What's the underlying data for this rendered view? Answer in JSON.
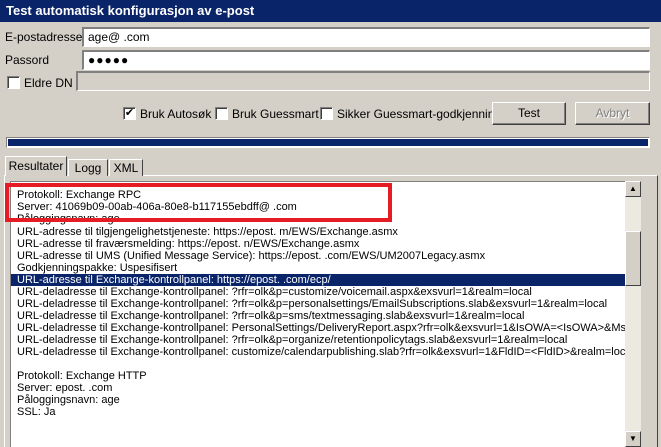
{
  "window": {
    "title": "Test automatisk konfigurasjon av e-post"
  },
  "form": {
    "email_label": "E-postadresse",
    "email_value": "age@            .com",
    "password_label": "Passord",
    "password_value": "●●●●●",
    "legacy_dn_label": "Eldre DN",
    "legacy_dn_value": ""
  },
  "options": {
    "autodiscover_label": "Bruk Autosøk",
    "autodiscover_checked": true,
    "autodiscover_mark": "✔",
    "guessmart_label": "Bruk Guessmart",
    "guessmart_checked": false,
    "secure_guessmart_label": "Sikker Guessmart-godkjenning",
    "secure_guessmart_checked": false
  },
  "buttons": {
    "test": "Test",
    "cancel": "Avbryt"
  },
  "progress": {
    "fraction": 1.0
  },
  "tabs": [
    "Resultater",
    "Logg",
    "XML"
  ],
  "results": {
    "selected_index": 7,
    "lines": [
      "Protokoll: Exchange RPC",
      "Server: 41069b09-00ab-406a-80e8-b117155ebdff@            .com",
      "Påloggingsnavn: age",
      "URL-adresse til tilgjengelighetstjeneste: https://epost.           m/EWS/Exchange.asmx",
      "URL-adresse til fraværsmelding: https://epost.            n/EWS/Exchange.asmx",
      "URL-adresse til UMS (Unified Message Service): https://epost.             .com/EWS/UM2007Legacy.asmx",
      "Godkjenningspakke: Uspesifisert",
      "URL-adresse til Exchange-kontrollpanel: https://epost.          .com/ecp/",
      "URL-deladresse til Exchange-kontrollpanel: ?rfr=olk&p=customize/voicemail.aspx&exsvurl=1&realm=local",
      "URL-deladresse til Exchange-kontrollpanel: ?rfr=olk&p=personalsettings/EmailSubscriptions.slab&exsvurl=1&realm=local",
      "URL-deladresse til Exchange-kontrollpanel: ?rfr=olk&p=sms/textmessaging.slab&exsvurl=1&realm=local",
      "URL-deladresse til Exchange-kontrollpanel: PersonalSettings/DeliveryReport.aspx?rfr=olk&exsvurl=1&IsOWA=<IsOWA>&Msg",
      "URL-deladresse til Exchange-kontrollpanel: ?rfr=olk&p=organize/retentionpolicytags.slab&exsvurl=1&realm=local",
      "URL-deladresse til Exchange-kontrollpanel: customize/calendarpublishing.slab?rfr=olk&exsvurl=1&FldID=<FldID>&realm=local",
      "",
      "Protokoll: Exchange HTTP",
      "Server: epost.           .com",
      "Påloggingsnavn: age",
      "SSL: Ja"
    ]
  },
  "scrollbar": {
    "up_icon": "▲",
    "down_icon": "▼"
  }
}
